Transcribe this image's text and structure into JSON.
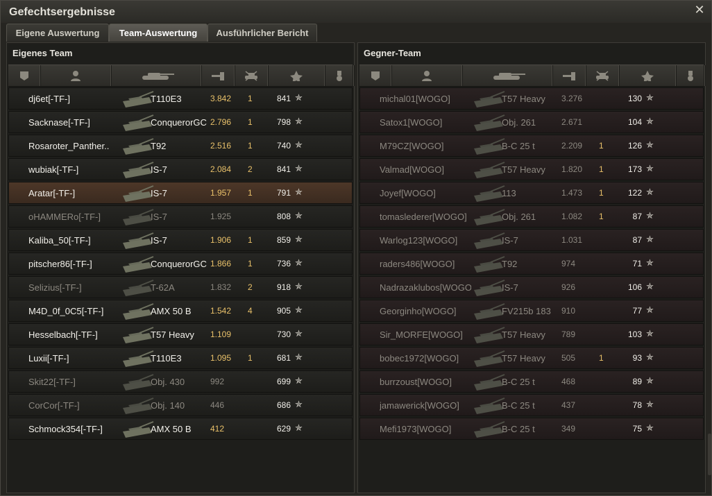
{
  "window": {
    "title": "Gefechtsergebnisse",
    "close_icon": "close-icon"
  },
  "tabs": [
    {
      "label": "Eigene Auswertung",
      "active": false
    },
    {
      "label": "Team-Auswertung",
      "active": true
    },
    {
      "label": "Ausführlicher Bericht",
      "active": false
    }
  ],
  "own_team": {
    "title": "Eigenes Team",
    "rows": [
      {
        "player": "dj6et[-TF-]",
        "tank": "T110E3",
        "damage": "3.842",
        "kills": "1",
        "xp": "841",
        "state": "alive"
      },
      {
        "player": "Sacknase[-TF-]",
        "tank": "ConquerorGC",
        "damage": "2.796",
        "kills": "1",
        "xp": "798",
        "state": "alive"
      },
      {
        "player": "Rosaroter_Panther..",
        "tank": "T92",
        "damage": "2.516",
        "kills": "1",
        "xp": "740",
        "state": "alive"
      },
      {
        "player": "wubiak[-TF-]",
        "tank": "IS-7",
        "damage": "2.084",
        "kills": "2",
        "xp": "841",
        "state": "alive"
      },
      {
        "player": "Aratar[-TF-]",
        "tank": "IS-7",
        "damage": "1.957",
        "kills": "1",
        "xp": "791",
        "state": "self"
      },
      {
        "player": "oHAMMERo[-TF-]",
        "tank": "IS-7",
        "damage": "1.925",
        "kills": "",
        "xp": "808",
        "state": "dead"
      },
      {
        "player": "Kaliba_50[-TF-]",
        "tank": "IS-7",
        "damage": "1.906",
        "kills": "1",
        "xp": "859",
        "state": "alive"
      },
      {
        "player": "pitscher86[-TF-]",
        "tank": "ConquerorGC",
        "damage": "1.866",
        "kills": "1",
        "xp": "736",
        "state": "alive"
      },
      {
        "player": "Selizius[-TF-]",
        "tank": "T-62A",
        "damage": "1.832",
        "kills": "2",
        "xp": "918",
        "state": "dead"
      },
      {
        "player": "M4D_0f_0C5[-TF-]",
        "tank": "AMX 50 B",
        "damage": "1.542",
        "kills": "4",
        "xp": "905",
        "state": "alive"
      },
      {
        "player": "Hesselbach[-TF-]",
        "tank": "T57 Heavy",
        "damage": "1.109",
        "kills": "",
        "xp": "730",
        "state": "alive"
      },
      {
        "player": "Luxii[-TF-]",
        "tank": "T110E3",
        "damage": "1.095",
        "kills": "1",
        "xp": "681",
        "state": "alive"
      },
      {
        "player": "Skit22[-TF-]",
        "tank": "Obj. 430",
        "damage": "992",
        "kills": "",
        "xp": "699",
        "state": "dead"
      },
      {
        "player": "CorCor[-TF-]",
        "tank": "Obj. 140",
        "damage": "446",
        "kills": "",
        "xp": "686",
        "state": "dead"
      },
      {
        "player": "Schmock354[-TF-]",
        "tank": "AMX 50 B",
        "damage": "412",
        "kills": "",
        "xp": "629",
        "state": "alive"
      }
    ]
  },
  "enemy_team": {
    "title": "Gegner-Team",
    "rows": [
      {
        "player": "michal01[WOGO]",
        "tank": "T57 Heavy",
        "damage": "3.276",
        "kills": "",
        "xp": "130",
        "state": "dead"
      },
      {
        "player": "Satox1[WOGO]",
        "tank": "Obj. 261",
        "damage": "2.671",
        "kills": "",
        "xp": "104",
        "state": "dead"
      },
      {
        "player": "M79CZ[WOGO]",
        "tank": "B-C 25 t",
        "damage": "2.209",
        "kills": "1",
        "xp": "126",
        "state": "dead"
      },
      {
        "player": "Valmad[WOGO]",
        "tank": "T57 Heavy",
        "damage": "1.820",
        "kills": "1",
        "xp": "173",
        "state": "dead"
      },
      {
        "player": "Joyef[WOGO]",
        "tank": "113",
        "damage": "1.473",
        "kills": "1",
        "xp": "122",
        "state": "dead"
      },
      {
        "player": "tomaslederer[WOGO]",
        "tank": "Obj. 261",
        "damage": "1.082",
        "kills": "1",
        "xp": "87",
        "state": "dead"
      },
      {
        "player": "Warlog123[WOGO]",
        "tank": "IS-7",
        "damage": "1.031",
        "kills": "",
        "xp": "87",
        "state": "dead"
      },
      {
        "player": "raders486[WOGO]",
        "tank": "T92",
        "damage": "974",
        "kills": "",
        "xp": "71",
        "state": "dead"
      },
      {
        "player": "Nadrazaklubos[WOGO]",
        "tank": "IS-7",
        "damage": "926",
        "kills": "",
        "xp": "106",
        "state": "dead"
      },
      {
        "player": "Georginho[WOGO]",
        "tank": "FV215b 183",
        "damage": "910",
        "kills": "",
        "xp": "77",
        "state": "dead"
      },
      {
        "player": "Sir_MORFE[WOGO]",
        "tank": "T57 Heavy",
        "damage": "789",
        "kills": "",
        "xp": "103",
        "state": "dead"
      },
      {
        "player": "bobec1972[WOGO]",
        "tank": "T57 Heavy",
        "damage": "505",
        "kills": "1",
        "xp": "93",
        "state": "dead"
      },
      {
        "player": "burrzoust[WOGO]",
        "tank": "B-C 25 t",
        "damage": "468",
        "kills": "",
        "xp": "89",
        "state": "dead"
      },
      {
        "player": "jamawerick[WOGO]",
        "tank": "B-C 25 t",
        "damage": "437",
        "kills": "",
        "xp": "78",
        "state": "dead"
      },
      {
        "player": "Mefi1973[WOGO]",
        "tank": "B-C 25 t",
        "damage": "349",
        "kills": "",
        "xp": "75",
        "state": "dead"
      }
    ]
  },
  "columns": [
    "squad-icon",
    "player-icon",
    "tank-icon",
    "damage-icon",
    "kills-icon",
    "xp-star-icon",
    "medal-icon"
  ],
  "xp_star_glyph": "✯",
  "colors": {
    "accent": "#e9c16a",
    "self_row": "#4d3728",
    "enemy_row": "#2f2424"
  }
}
